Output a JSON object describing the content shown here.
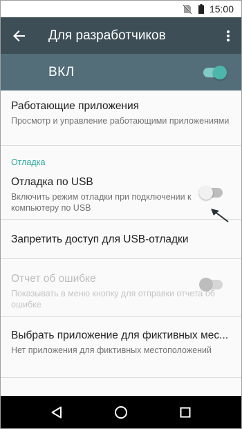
{
  "status": {
    "time": "15:00",
    "icons": [
      "no-sim-icon",
      "battery-icon"
    ]
  },
  "toolbar": {
    "title": "Для разработчиков",
    "back_icon": "arrow-back-icon",
    "menu_icon": "more-vert-icon"
  },
  "master": {
    "label": "ВКЛ",
    "enabled": true
  },
  "items": {
    "running_apps": {
      "title": "Работающие приложения",
      "summary": "Просмотр и управление работающими приложениями"
    },
    "category_debugging": "Отладка",
    "usb_debugging": {
      "title": "Отладка по USB",
      "summary": "Включить режим отладки при подключении к компьютеру по USB",
      "enabled": false
    },
    "revoke_usb": {
      "title": "Запретить доступ для USB-отладки"
    },
    "bug_report": {
      "title": "Отчет об ошибке",
      "summary": "Показывать в меню кнопку для отправки отчета об ошибке",
      "enabled": false,
      "disabled": true
    },
    "mock_location": {
      "title": "Выбрать приложение для фиктивных мес...",
      "summary": "Нет приложения для фиктивных местоположений"
    }
  },
  "colors": {
    "toolbar": "#3d4e56",
    "master_bar": "#546e79",
    "accent": "#26a69a"
  },
  "navbar": {
    "icons": [
      "back-triangle-icon",
      "home-circle-icon",
      "recents-square-icon"
    ]
  }
}
